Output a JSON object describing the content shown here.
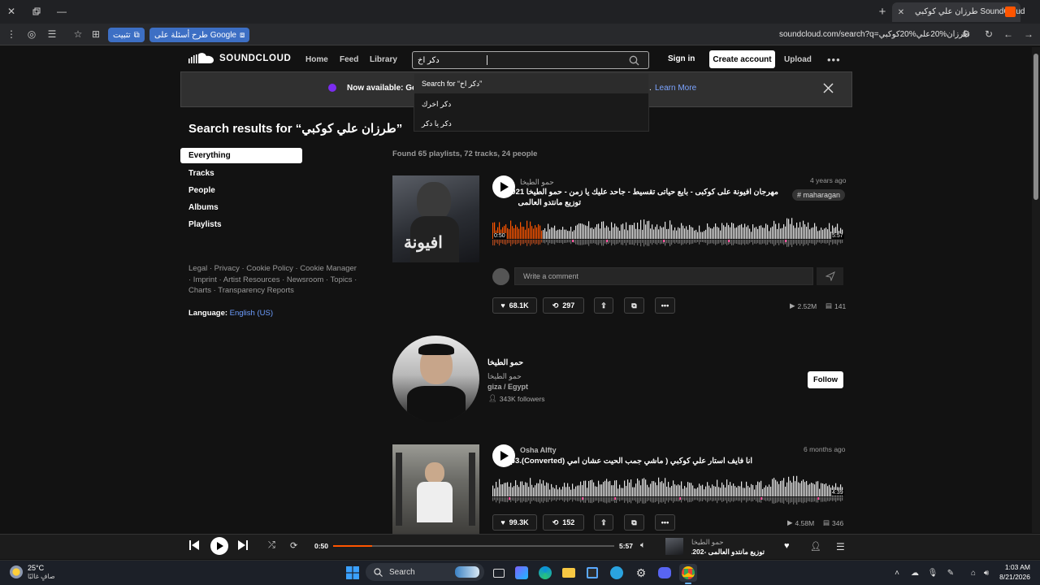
{
  "browser": {
    "tab_title": "طرزان علي كوكبي SoundCloud",
    "url": "soundcloud.com/search?q=طرزان%20علي%20كوكبي",
    "pill_google": "طرح أسئلة على Google",
    "pill_install": "تثبيت"
  },
  "header": {
    "logo_text": "SOUNDCLOUD",
    "nav": [
      "Home",
      "Feed",
      "Library"
    ],
    "search_value": "دكر اخ",
    "sign_in": "Sign in",
    "create_account": "Create account",
    "upload": "Upload"
  },
  "banner": {
    "text": "Now available: Get",
    "link": "Learn More"
  },
  "dropdown": {
    "items": [
      "Search for “دكر اخ”",
      "دكر اخرك",
      "دكر يا دكر"
    ]
  },
  "sidebar": {
    "title": "Search results for “طرزان علي كوكبي”",
    "filters": [
      "Everything",
      "Tracks",
      "People",
      "Albums",
      "Playlists"
    ],
    "footer_links": "Legal · Privacy · Cookie Policy · Cookie Manager · Imprint · Artist Resources · Newsroom · Topics · Charts · Transparency Reports",
    "language_label": "Language:",
    "language_value": "English (US)"
  },
  "results": {
    "found": "Found 65 playlists, 72 tracks, 24 people",
    "track1": {
      "user": "حمو الطيخا",
      "title_line1": "مهرجان افيونة على كوكبى - بايع حياتى تقسيط - جاحد عليك يا زمن - حمو الطيخا 2021-",
      "title_line2": "توزيع مانتدو العالمى",
      "ago": "4 years ago",
      "tag": "# maharagan",
      "time_start": "0:50",
      "time_end": "5:57",
      "progress": 0.14,
      "likes": "68.1K",
      "reposts": "297",
      "plays": "2.52M",
      "comments": "141",
      "comment_placeholder": "Write a comment"
    },
    "person": {
      "name": "حمو الطيخا",
      "username": "حمو الطيخا",
      "location": "giza / Egypt",
      "followers": "343K followers",
      "follow": "Follow"
    },
    "track2": {
      "user": "Osha Alfty",
      "title": "انا فايف استار علي كوكبي ( ماشي جمب الحيت عشان امي (Converted).mp3",
      "ago": "6 months ago",
      "time_end": "4:39",
      "likes": "99.3K",
      "reposts": "152",
      "plays": "4.58M",
      "comments": "346"
    }
  },
  "player": {
    "elapsed": "0:50",
    "duration": "5:57",
    "progress": 0.14,
    "artist": "حمو الطيخا",
    "title": "توزيع مانتدو العالمى -202..."
  },
  "taskbar": {
    "weather_temp": "25°C",
    "weather_desc": "صافٍ غالبًا",
    "search_label": "Search",
    "time": "1:03 AM",
    "date": "8/21/2026"
  },
  "colors": {
    "accent": "#ff5500",
    "link": "#6d9eff",
    "banner_bg": "#303030"
  }
}
